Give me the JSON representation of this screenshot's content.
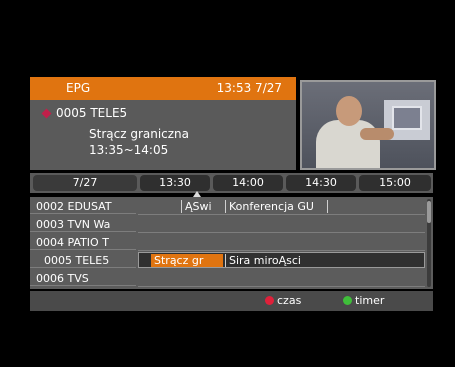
{
  "header": {
    "title": "EPG",
    "clock": "13:53 7/27"
  },
  "info": {
    "channel": "0005 TELE5",
    "program": "Strącz graniczna",
    "time": "13:35~14:05"
  },
  "timeline": {
    "date": "7/27",
    "slots": [
      "13:30",
      "14:00",
      "14:30",
      "15:00"
    ]
  },
  "channels": [
    {
      "name": "0002 EDUSAT",
      "events": [
        {
          "title": "ĄSwi"
        },
        {
          "title": "Konferencja GU"
        }
      ]
    },
    {
      "name": "0003 TVN Wa",
      "events": []
    },
    {
      "name": "0004 PATIO T",
      "events": []
    },
    {
      "name": "0005 TELE5",
      "events": [
        {
          "title": "Strącz gr"
        },
        {
          "title": "Sira miroĄsci"
        }
      ]
    },
    {
      "name": "0006 TVS",
      "events": []
    }
  ],
  "footer": {
    "red_label": "czas",
    "green_label": "timer",
    "red_color": "#e0203a",
    "green_color": "#3fbf3a"
  },
  "accent_color": "#e07410"
}
